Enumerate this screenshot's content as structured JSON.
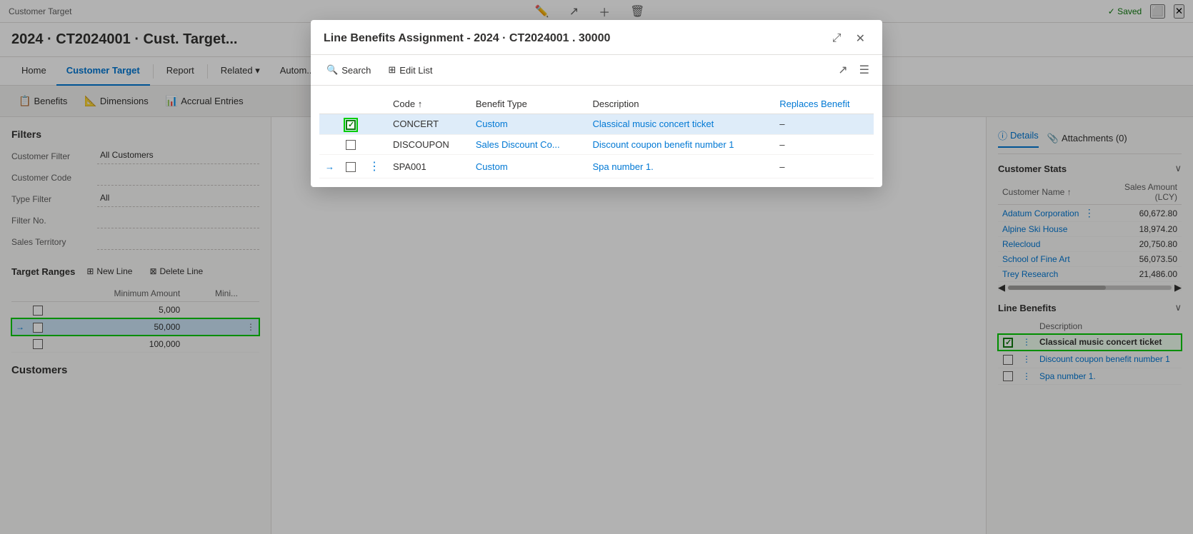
{
  "app": {
    "breadcrumb": "Customer Target",
    "page_title": "2024 · CT2024001 · Cust. Target...",
    "saved_label": "✓ Saved"
  },
  "nav": {
    "tabs": [
      {
        "label": "Home",
        "active": false
      },
      {
        "label": "Customer Target",
        "active": true
      },
      {
        "label": "Report",
        "active": false
      },
      {
        "label": "Related",
        "active": false,
        "dropdown": true
      },
      {
        "label": "Autom...",
        "active": false
      }
    ]
  },
  "action_bar": {
    "benefits_label": "Benefits",
    "dimensions_label": "Dimensions",
    "accrual_entries_label": "Accrual Entries"
  },
  "filters": {
    "section_title": "Filters",
    "customer_filter_label": "Customer Filter",
    "customer_filter_value": "All Customers",
    "customer_code_label": "Customer Code",
    "customer_code_value": "",
    "type_filter_label": "Type Filter",
    "type_filter_value": "All",
    "filter_no_label": "Filter No.",
    "filter_no_value": "",
    "sales_territory_label": "Sales Territory",
    "sales_territory_value": ""
  },
  "target_ranges": {
    "title": "Target Ranges",
    "new_line_label": "New Line",
    "delete_line_label": "Delete Line",
    "columns": [
      "Minimum Amount",
      "Mini..."
    ],
    "rows": [
      {
        "min_amount": "5,000",
        "mini": "",
        "selected": false,
        "arrow": false
      },
      {
        "min_amount": "50,000",
        "mini": "",
        "selected": true,
        "arrow": true
      },
      {
        "min_amount": "100,000",
        "mini": "",
        "selected": false,
        "arrow": false
      }
    ]
  },
  "customers": {
    "label": "Customers"
  },
  "right_panel": {
    "details_tab": "Details",
    "attachments_tab": "Attachments (0)",
    "customer_stats": {
      "title": "Customer Stats",
      "col_name": "Customer Name ↑",
      "col_amount": "Sales Amount (LCY)",
      "rows": [
        {
          "name": "Adatum Corporation",
          "amount": "60,672.80"
        },
        {
          "name": "Alpine Ski House",
          "amount": "18,974.20"
        },
        {
          "name": "Relecloud",
          "amount": "20,750.80"
        },
        {
          "name": "School of Fine Art",
          "amount": "56,073.50"
        },
        {
          "name": "Trey Research",
          "amount": "21,486.00"
        }
      ]
    },
    "line_benefits": {
      "title": "Line Benefits",
      "col_description": "Description",
      "rows": [
        {
          "description": "Classical music concert ticket",
          "checked": true,
          "highlighted": true
        },
        {
          "description": "Discount coupon benefit number 1",
          "checked": false,
          "highlighted": false
        },
        {
          "description": "Spa number 1.",
          "checked": false,
          "highlighted": false
        }
      ]
    }
  },
  "modal": {
    "title": "Line Benefits Assignment - 2024 · CT2024001 . 30000",
    "search_label": "Search",
    "edit_list_label": "Edit List",
    "columns": {
      "code": "Code ↑",
      "benefit_type": "Benefit Type",
      "description": "Description",
      "replaces_benefit": "Replaces Benefit"
    },
    "rows": [
      {
        "code": "CONCERT",
        "benefit_type": "Custom",
        "description": "Classical music concert ticket",
        "replaces_benefit": "–",
        "checked": true,
        "arrow": false,
        "context": false
      },
      {
        "code": "DISCOUPON",
        "benefit_type": "Sales Discount Co...",
        "description": "Discount coupon benefit number 1",
        "replaces_benefit": "–",
        "checked": false,
        "arrow": false,
        "context": false
      },
      {
        "code": "SPA001",
        "benefit_type": "Custom",
        "description": "Spa number 1.",
        "replaces_benefit": "–",
        "checked": false,
        "arrow": true,
        "context": true
      }
    ]
  }
}
